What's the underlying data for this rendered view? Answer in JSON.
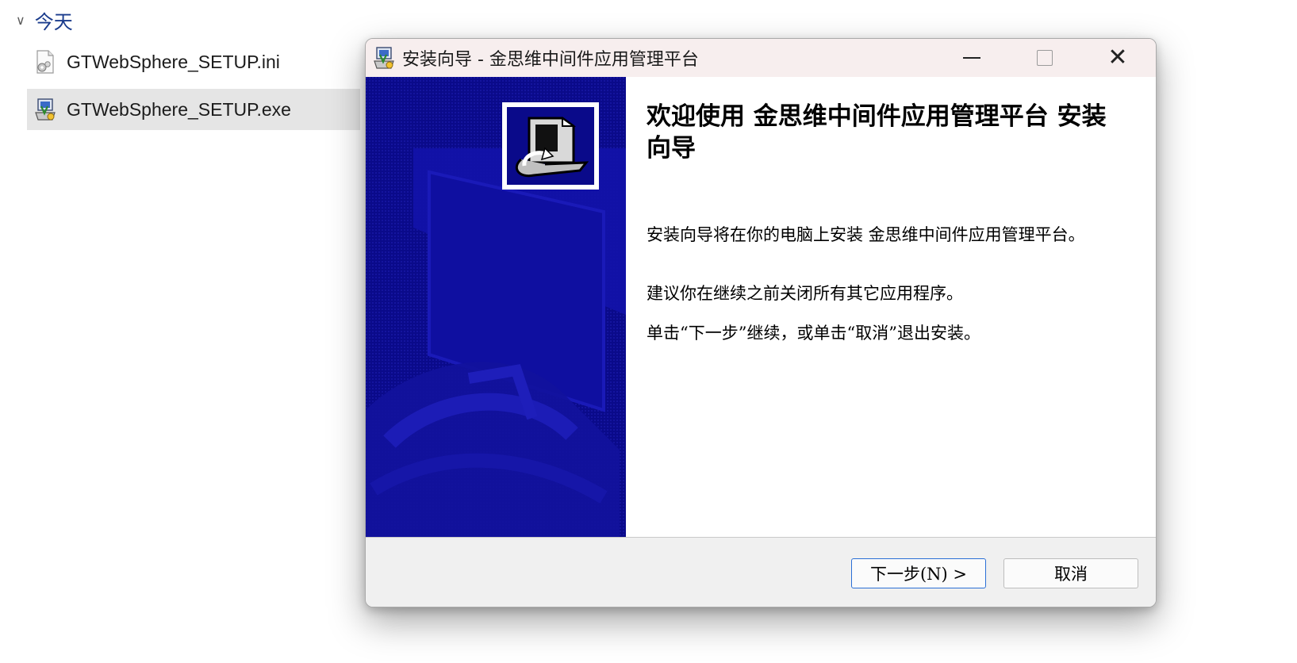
{
  "explorer": {
    "group_chevron": "∨",
    "group_title": "今天",
    "files": [
      {
        "name": "GTWebSphere_SETUP.ini",
        "icon": "settings-file-icon"
      },
      {
        "name": "GTWebSphere_SETUP.exe",
        "icon": "installer-icon"
      }
    ]
  },
  "dialog": {
    "title": "安装向导 - 金思维中间件应用管理平台",
    "heading": "欢迎使用 金思维中间件应用管理平台 安装向导",
    "paragraphs": [
      "安装向导将在你的电脑上安装 金思维中间件应用管理平台。",
      "建议你在继续之前关闭所有其它应用程序。",
      "单击“下一步”继续，或单击“取消”退出安装。"
    ],
    "buttons": {
      "next": "下一步(N) >",
      "cancel": "取消"
    },
    "window_controls": {
      "close_glyph": "✕"
    }
  },
  "colors": {
    "side_panel": "#0a0a8a",
    "accent_border": "#2b6fd6",
    "selected_row": "#e5e5e5",
    "group_title": "#1a3b8c"
  }
}
